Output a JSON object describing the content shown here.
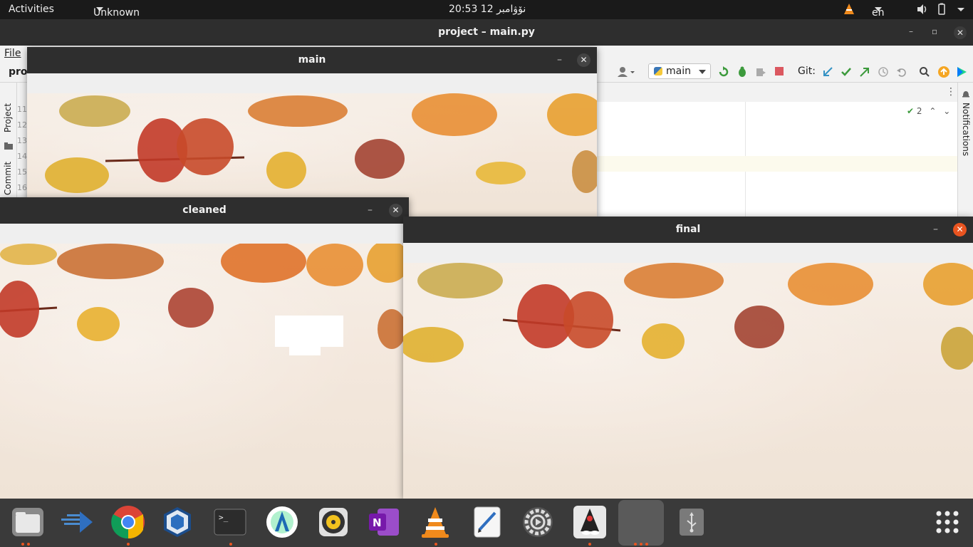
{
  "topbar": {
    "activities": "Activities",
    "app_menu": "Unknown",
    "clock": "20:53  12 نۆۋامبر",
    "language": "en",
    "icons": [
      "vlc-tray-icon",
      "volume-icon",
      "battery-icon",
      "power-icon"
    ]
  },
  "ide": {
    "title": "project – main.py",
    "menu_file": "File",
    "project_label": "proj",
    "run_config": "main",
    "git_label": "Git:",
    "left_tabs": [
      "Project",
      "Commit"
    ],
    "right_tab": "Notifications",
    "line_numbers": [
      "11",
      "12",
      "13",
      "14",
      "15",
      "16"
    ],
    "inspection_count": "2"
  },
  "windows": {
    "main": {
      "title": "main"
    },
    "cleaned": {
      "title": "cleaned"
    },
    "final": {
      "title": "final"
    },
    "minimize_glyph": "–",
    "close_glyph": "✕"
  },
  "dock": {
    "items": [
      "files",
      "code-editor",
      "chrome",
      "virtualbox",
      "terminal",
      "android-studio",
      "rhythmbox",
      "onenote",
      "vlc",
      "text-editor",
      "settings",
      "java-app",
      "active-window",
      "usb-drive"
    ],
    "show_apps": "show-applications"
  },
  "colors": {
    "accent": "#e95420",
    "titlebar": "#2e2e2e",
    "dock": "#3a3a3a"
  }
}
